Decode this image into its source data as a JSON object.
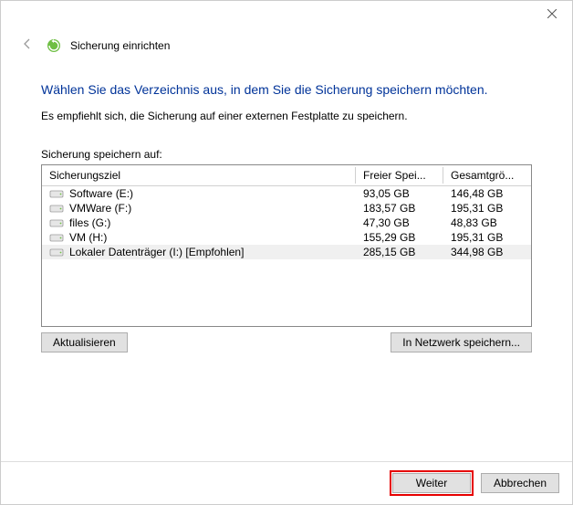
{
  "window": {
    "title": "Sicherung einrichten"
  },
  "heading": "Wählen Sie das Verzeichnis aus, in dem Sie die Sicherung speichern möchten.",
  "subtext": "Es empfiehlt sich, die Sicherung auf einer externen Festplatte zu speichern.",
  "table_label": "Sicherung speichern auf:",
  "columns": {
    "target": "Sicherungsziel",
    "free": "Freier Spei...",
    "total": "Gesamtgrö..."
  },
  "drives": [
    {
      "name": "Software (E:)",
      "free": "93,05 GB",
      "total": "146,48 GB",
      "selected": false
    },
    {
      "name": "VMWare (F:)",
      "free": "183,57 GB",
      "total": "195,31 GB",
      "selected": false
    },
    {
      "name": "files (G:)",
      "free": "47,30 GB",
      "total": "48,83 GB",
      "selected": false
    },
    {
      "name": "VM (H:)",
      "free": "155,29 GB",
      "total": "195,31 GB",
      "selected": false
    },
    {
      "name": "Lokaler Datenträger (I:) [Empfohlen]",
      "free": "285,15 GB",
      "total": "344,98 GB",
      "selected": true
    }
  ],
  "buttons": {
    "refresh": "Aktualisieren",
    "save_network": "In Netzwerk speichern...",
    "next": "Weiter",
    "cancel": "Abbrechen"
  }
}
